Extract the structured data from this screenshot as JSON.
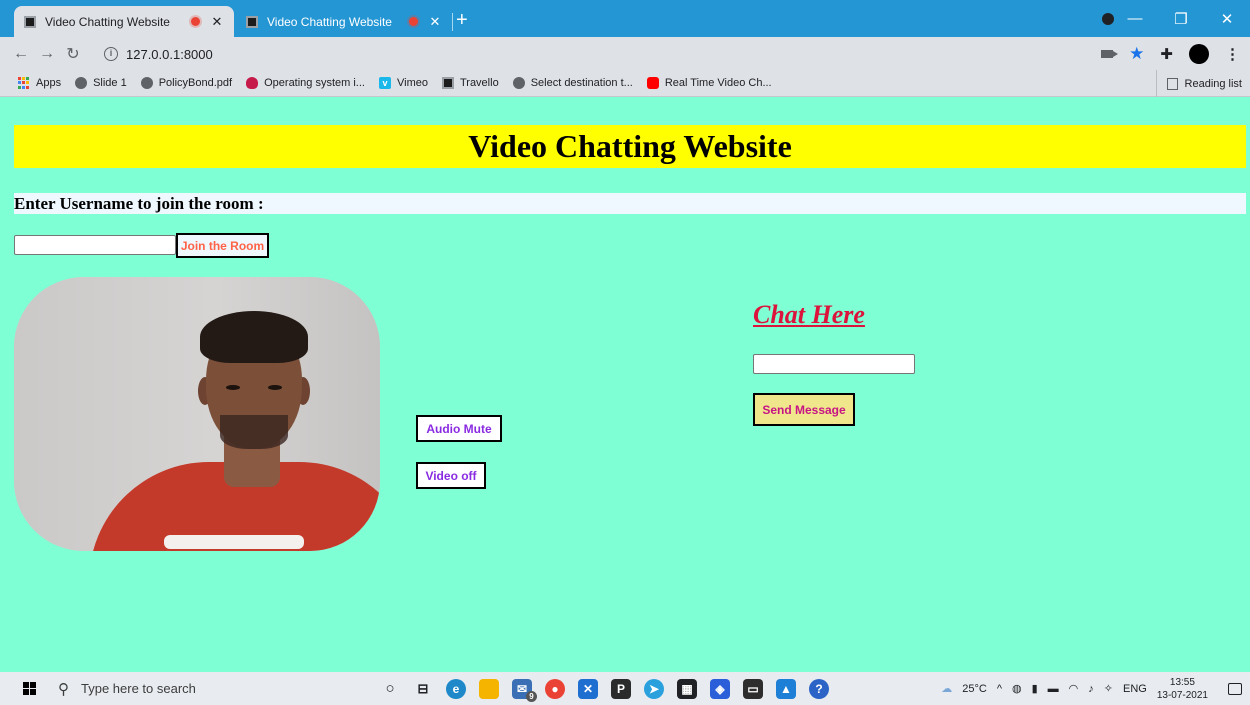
{
  "browser": {
    "tabs": [
      {
        "title": "Video Chatting Website",
        "active": true,
        "recording": true
      },
      {
        "title": "Video Chatting Website",
        "active": false,
        "recording": true
      }
    ],
    "new_tab": "+",
    "address": "127.0.0.1:8000",
    "bookmarks": [
      {
        "label": "Apps",
        "icon": "apps-grid-icon"
      },
      {
        "label": "Slide 1",
        "icon": "globe-icon"
      },
      {
        "label": "PolicyBond.pdf",
        "icon": "globe-icon"
      },
      {
        "label": "Operating system i...",
        "icon": "raspberry-icon"
      },
      {
        "label": "Vimeo",
        "icon": "vimeo-icon"
      },
      {
        "label": "Travello",
        "icon": "site-icon"
      },
      {
        "label": "Select destination t...",
        "icon": "globe-icon"
      },
      {
        "label": "Real Time Video Ch...",
        "icon": "youtube-icon"
      }
    ],
    "reading_list": "Reading list",
    "colors": {
      "titlebar": "#2596d4",
      "toolbar": "#dee1e6"
    }
  },
  "page": {
    "header": "Video Chatting Website",
    "prompt": "Enter Username to join the room :",
    "username_value": "",
    "join_button": "Join the Room",
    "audio_button": "Audio Mute",
    "video_button": "Video off",
    "chat_heading": "Chat Here",
    "chat_value": "",
    "send_button": "Send Message",
    "colors": {
      "background": "#7fffd4",
      "header_bg": "#ffff00",
      "prompt_bg": "#f0f8ff",
      "join_text": "#ff6347",
      "control_text": "#8a2be2",
      "chat_heading": "#dc143c",
      "send_bg": "#f0e68c",
      "send_text": "#c71585"
    }
  },
  "taskbar": {
    "search_placeholder": "Type here to search",
    "weather": "25°C",
    "language": "ENG",
    "time": "13:55",
    "date": "13-07-2021",
    "badge": "9"
  }
}
